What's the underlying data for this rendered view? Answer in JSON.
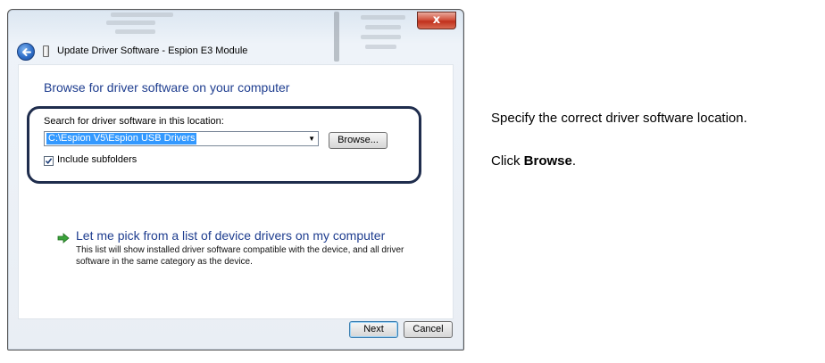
{
  "dialog": {
    "title": "Update Driver Software - Espion E3 Module",
    "close_label": "x",
    "heading": "Browse for driver software on your computer",
    "search_label": "Search for driver software in this location:",
    "path_value": "C:\\Espion V5\\Espion USB Drivers",
    "browse_label": "Browse...",
    "include_subfolders_label": "Include subfolders",
    "include_subfolders_checked": true,
    "pick_option_title": "Let me pick from a list of device drivers on my computer",
    "pick_option_description": "This list will show installed driver software compatible with the device, and all driver software in the same category as the device.",
    "next_label": "Next",
    "cancel_label": "Cancel",
    "icons": [
      "back-arrow-icon",
      "device-icon",
      "close-icon",
      "combo-dropdown-icon",
      "checkmark-icon",
      "green-arrow-icon"
    ]
  },
  "instructions": {
    "line1": "Specify the correct driver software location.",
    "line2_prefix": "Click ",
    "line2_bold": "Browse",
    "line2_suffix": "."
  },
  "colors": {
    "heading_blue": "#1e3d8f",
    "selection_blue": "#3399ff",
    "callout_border": "#1f2d4d",
    "close_red": "#c0301c"
  }
}
